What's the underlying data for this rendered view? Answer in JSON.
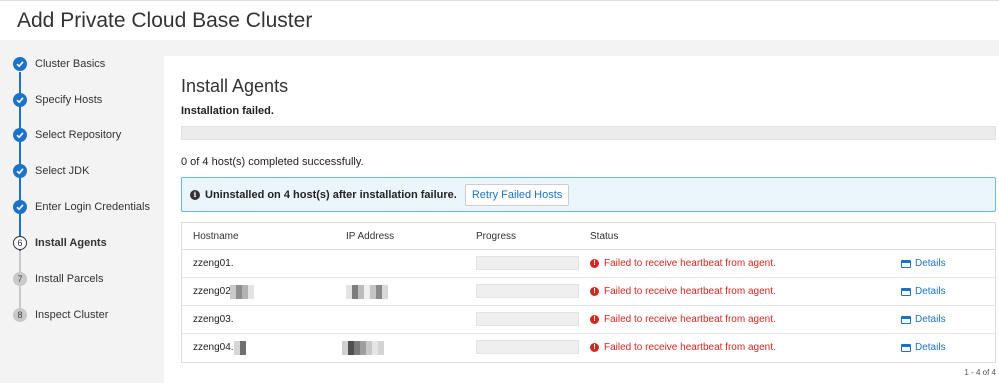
{
  "header": {
    "title": "Add Private Cloud Base Cluster"
  },
  "sidebar": {
    "steps": [
      {
        "label": "Cluster Basics",
        "state": "done",
        "marker": ""
      },
      {
        "label": "Specify Hosts",
        "state": "done",
        "marker": ""
      },
      {
        "label": "Select Repository",
        "state": "done",
        "marker": ""
      },
      {
        "label": "Select JDK",
        "state": "done",
        "marker": ""
      },
      {
        "label": "Enter Login Credentials",
        "state": "done",
        "marker": ""
      },
      {
        "label": "Install Agents",
        "state": "current",
        "marker": "6"
      },
      {
        "label": "Install Parcels",
        "state": "todo",
        "marker": "7"
      },
      {
        "label": "Inspect Cluster",
        "state": "todo",
        "marker": "8"
      }
    ]
  },
  "main": {
    "title": "Install Agents",
    "status": "Installation failed.",
    "summary": "0 of 4 host(s) completed successfully.",
    "alert": {
      "icon": "info-icon",
      "message": "Uninstalled on 4 host(s) after installation failure.",
      "button": "Retry Failed Hosts"
    },
    "table": {
      "headers": {
        "hostname": "Hostname",
        "ip": "IP Address",
        "progress": "Progress",
        "status": "Status"
      },
      "rows": [
        {
          "hostname": "zzeng01.",
          "status": "Failed to receive heartbeat from agent.",
          "details": "Details"
        },
        {
          "hostname": "zzeng02.",
          "status": "Failed to receive heartbeat from agent.",
          "details": "Details"
        },
        {
          "hostname": "zzeng03.",
          "status": "Failed to receive heartbeat from agent.",
          "details": "Details"
        },
        {
          "hostname": "zzeng04.",
          "status": "Failed to receive heartbeat from agent.",
          "details": "Details"
        }
      ]
    },
    "pager": "1 - 4 of 4"
  },
  "colors": {
    "accent": "#1a73c8",
    "error": "#d0281e",
    "alert_bg": "#eaf6fc",
    "alert_border": "#6cb9df"
  }
}
